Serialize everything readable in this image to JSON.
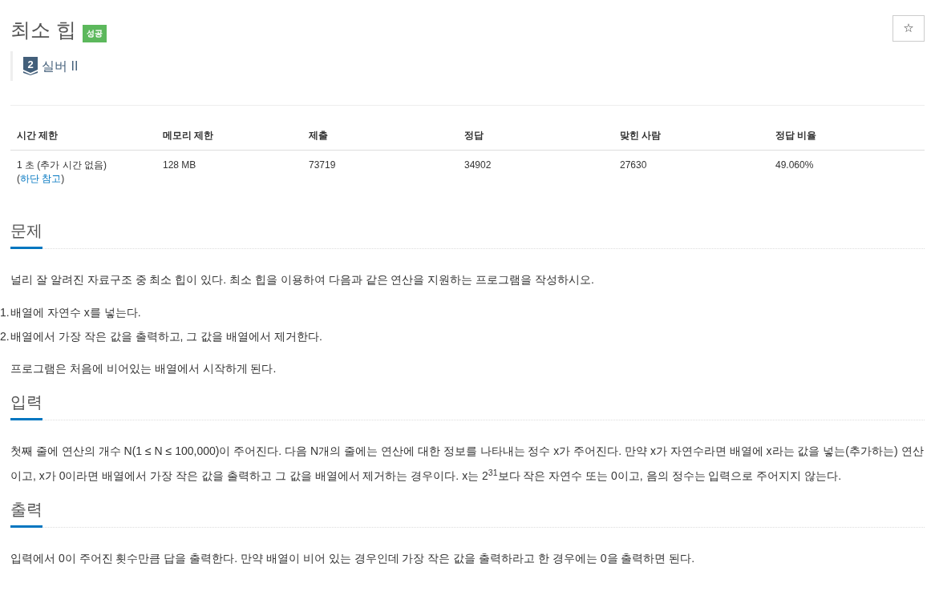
{
  "problem_header": {
    "title": "최소 힙",
    "result_badge": "성공",
    "star_button": "☆",
    "tier": {
      "digit": "2",
      "label": "실버 II"
    }
  },
  "stats_table": {
    "columns": [
      "시간 제한",
      "메모리 제한",
      "제출",
      "정답",
      "맞힌 사람",
      "정답 비율"
    ],
    "rows": [
      {
        "cells": [
          [
            {
              "kind": "text",
              "text": "1 초 (추가 시간 없음) ("
            },
            {
              "kind": "link",
              "text": "하단 참고"
            },
            {
              "kind": "text",
              "text": ")"
            }
          ],
          [
            {
              "kind": "text",
              "text": "128 MB"
            }
          ],
          [
            {
              "kind": "text",
              "text": "73719"
            }
          ],
          [
            {
              "kind": "text",
              "text": "34902"
            }
          ],
          [
            {
              "kind": "text",
              "text": "27630"
            }
          ],
          [
            {
              "kind": "text",
              "text": "49.060%"
            }
          ]
        ]
      }
    ]
  },
  "sections": [
    {
      "heading": "문제",
      "blocks": [
        {
          "kind": "paragraph",
          "text": "널리 잘 알려진 자료구조 중 최소 힙이 있다. 최소 힙을 이용하여 다음과 같은 연산을 지원하는 프로그램을 작성하시오."
        },
        {
          "kind": "ordered_list",
          "items": [
            {
              "marker": "1.",
              "text": "배열에 자연수 x를 넣는다."
            },
            {
              "marker": "2.",
              "text": "배열에서 가장 작은 값을 출력하고, 그 값을 배열에서 제거한다."
            }
          ]
        },
        {
          "kind": "paragraph",
          "text": "프로그램은 처음에 비어있는 배열에서 시작하게 된다."
        }
      ]
    },
    {
      "heading": "입력",
      "blocks": [
        {
          "kind": "paragraph",
          "text": "첫째 줄에 연산의 개수 N(1 ≤ N ≤ 100,000)이 주어진다. 다음 N개의 줄에는 연산에 대한 정보를 나타내는 정수 x가 주어진다. 만약 x가 자연수라면 배열에 x라는 값을 넣는(추가하는) 연산이고, x가 0이라면 배열에서 가장 작은 값을 출력하고 그 값을 배열에서 제거하는 경우이다. x는 2$^{31}$보다 작은 자연수 또는 0이고, 음의 정수는 입력으로 주어지지 않는다."
        }
      ]
    },
    {
      "heading": "출력",
      "blocks": [
        {
          "kind": "paragraph",
          "text": "입력에서 0이 주어진 횟수만큼 답을 출력한다. 만약 배열이 비어 있는 경우인데 가장 작은 값을 출력하라고 한 경우에는 0을 출력하면 된다."
        }
      ]
    }
  ]
}
